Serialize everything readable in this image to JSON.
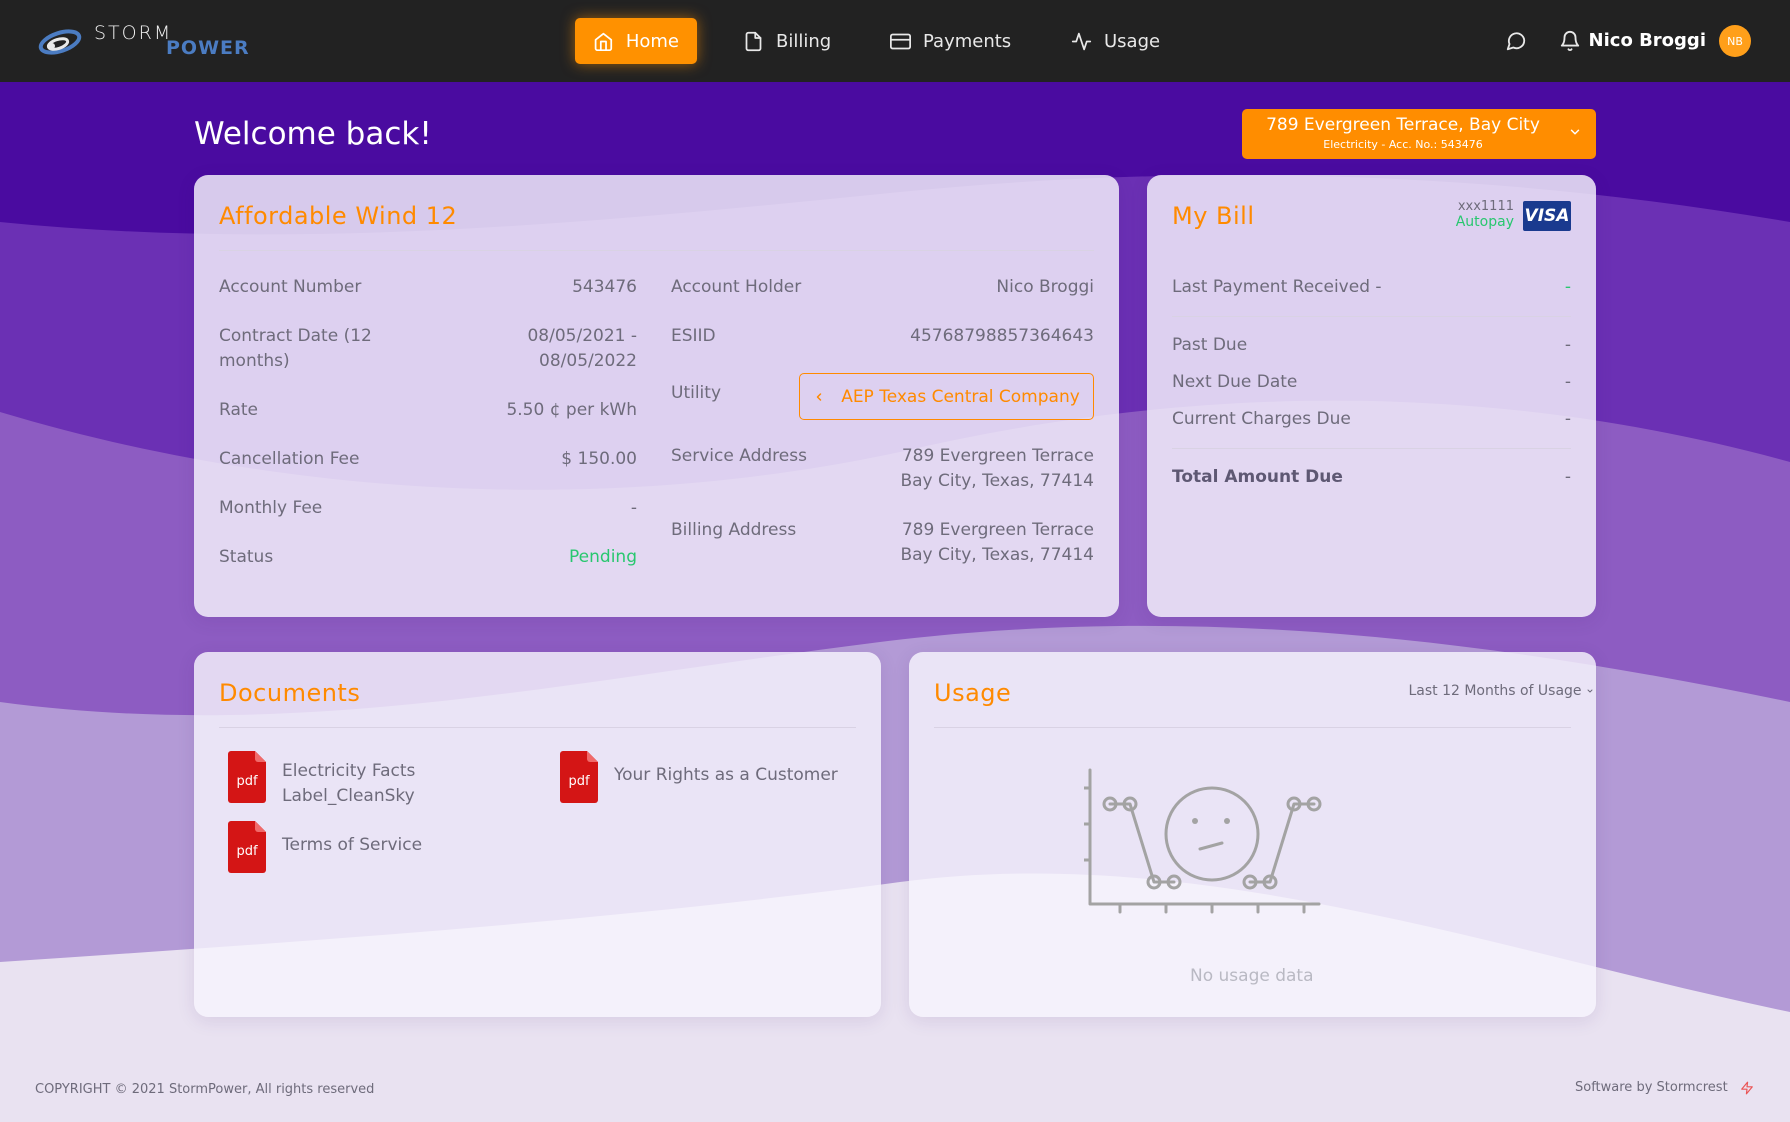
{
  "brand": {
    "name_part1": "STORM",
    "name_part2": "POWER"
  },
  "nav": {
    "items": [
      {
        "label": "Home",
        "icon": "home-icon",
        "active": true
      },
      {
        "label": "Billing",
        "icon": "file-icon",
        "active": false
      },
      {
        "label": "Payments",
        "icon": "credit-card-icon",
        "active": false
      },
      {
        "label": "Usage",
        "icon": "activity-icon",
        "active": false
      }
    ],
    "user_name": "Nico Broggi",
    "user_initials": "NB"
  },
  "header": {
    "welcome": "Welcome back!",
    "address_main": "789 Evergreen Terrace, Bay City",
    "address_sub": "Electricity - Acc. No.: 543476"
  },
  "plan": {
    "title": "Affordable Wind 12",
    "left": [
      {
        "label": "Account Number",
        "value": "543476"
      },
      {
        "label": "Contract Date (12",
        "label2": "months)",
        "value": "08/05/2021 -",
        "value2": "08/05/2022"
      },
      {
        "label": "Rate",
        "value": "5.50 ¢ per kWh"
      },
      {
        "label": "Cancellation Fee",
        "value": "$ 150.00"
      },
      {
        "label": "Monthly Fee",
        "value": "-"
      },
      {
        "label": "Status",
        "value": "Pending"
      }
    ],
    "right": {
      "holder_label": "Account Holder",
      "holder_value": "Nico Broggi",
      "esiid_label": "ESIID",
      "esiid_value": "45768798857364643",
      "utility_label": "Utility",
      "utility_value": "AEP Texas Central Company",
      "service_label": "Service Address",
      "service_line1": "789 Evergreen Terrace",
      "service_line2": "Bay City, Texas, 77414",
      "billing_label": "Billing Address",
      "billing_line1": "789 Evergreen Terrace",
      "billing_line2": "Bay City, Texas, 77414"
    }
  },
  "bill": {
    "title": "My Bill",
    "card_last4": "xxx1111",
    "autopay": "Autopay",
    "card_brand": "VISA",
    "last_payment_label": "Last Payment Received -",
    "last_payment_value": "-",
    "past_due_label": "Past Due",
    "past_due_value": "-",
    "next_due_label": "Next Due Date",
    "next_due_value": "-",
    "current_charges_label": "Current Charges Due",
    "current_charges_value": "-",
    "total_label": "Total Amount Due",
    "total_value": "-"
  },
  "documents": {
    "title": "Documents",
    "items": [
      {
        "line1": "Electricity Facts",
        "line2": "Label_CleanSky",
        "icon": "pdf-icon"
      },
      {
        "line1": "Your Rights as a Customer",
        "line2": "",
        "icon": "pdf-icon"
      },
      {
        "line1": "Terms of Service",
        "line2": "",
        "icon": "pdf-icon"
      }
    ],
    "pdf_label": "pdf"
  },
  "usage": {
    "title": "Usage",
    "range": "Last 12 Months of Usage",
    "empty": "No usage data"
  },
  "footer": {
    "copyright": "COPYRIGHT © 2021 StormPower, All rights reserved",
    "credit": "Software by Stormcrest"
  },
  "colors": {
    "accent": "#ff8a00",
    "nav_bg": "#222222",
    "brand_purple": "#4a0ba0",
    "success": "#28c76f",
    "visa": "#1a3a8f",
    "pdf_red": "#d41515"
  }
}
